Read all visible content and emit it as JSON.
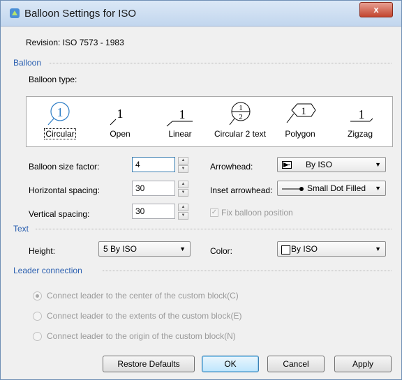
{
  "window": {
    "title": "Balloon Settings for ISO",
    "close_glyph": "x"
  },
  "revision": "Revision: ISO 7573 - 1983",
  "balloon": {
    "section_label": "Balloon",
    "type_label": "Balloon type:",
    "types": [
      {
        "label": "Circular",
        "glyph": "1"
      },
      {
        "label": "Open",
        "glyph": "1"
      },
      {
        "label": "Linear",
        "glyph": "1"
      },
      {
        "label": "Circular 2 text",
        "glyph_top": "1",
        "glyph_bottom": "2"
      },
      {
        "label": "Polygon",
        "glyph": "1"
      },
      {
        "label": "Zigzag",
        "glyph": "1"
      }
    ],
    "selected_type": "Circular",
    "size_factor_label": "Balloon size factor:",
    "size_factor_value": "4",
    "horizontal_spacing_label": "Horizontal spacing:",
    "horizontal_spacing_value": "30",
    "vertical_spacing_label": "Vertical spacing:",
    "vertical_spacing_value": "30",
    "arrowhead_label": "Arrowhead:",
    "arrowhead_value": "By ISO",
    "inset_arrowhead_label": "Inset arrowhead:",
    "inset_arrowhead_value": "Small Dot Filled",
    "fix_position_label": "Fix balloon position",
    "fix_position_checked": true
  },
  "text": {
    "section_label": "Text",
    "height_label": "Height:",
    "height_value": "5 By ISO",
    "color_label": "Color:",
    "color_value": "By ISO"
  },
  "leader": {
    "section_label": "Leader connection",
    "options": [
      {
        "label": "Connect leader to the center of the custom block(C)",
        "checked": true
      },
      {
        "label": "Connect leader to the extents of the custom block(E)",
        "checked": false
      },
      {
        "label": "Connect leader to the origin of the custom block(N)",
        "checked": false
      }
    ]
  },
  "buttons": {
    "restore": "Restore Defaults",
    "ok": "OK",
    "cancel": "Cancel",
    "apply": "Apply"
  },
  "colors": {
    "section_label": "#2a5fb0",
    "disabled_text": "#9a9a9a",
    "close_button": "#c2452f"
  }
}
